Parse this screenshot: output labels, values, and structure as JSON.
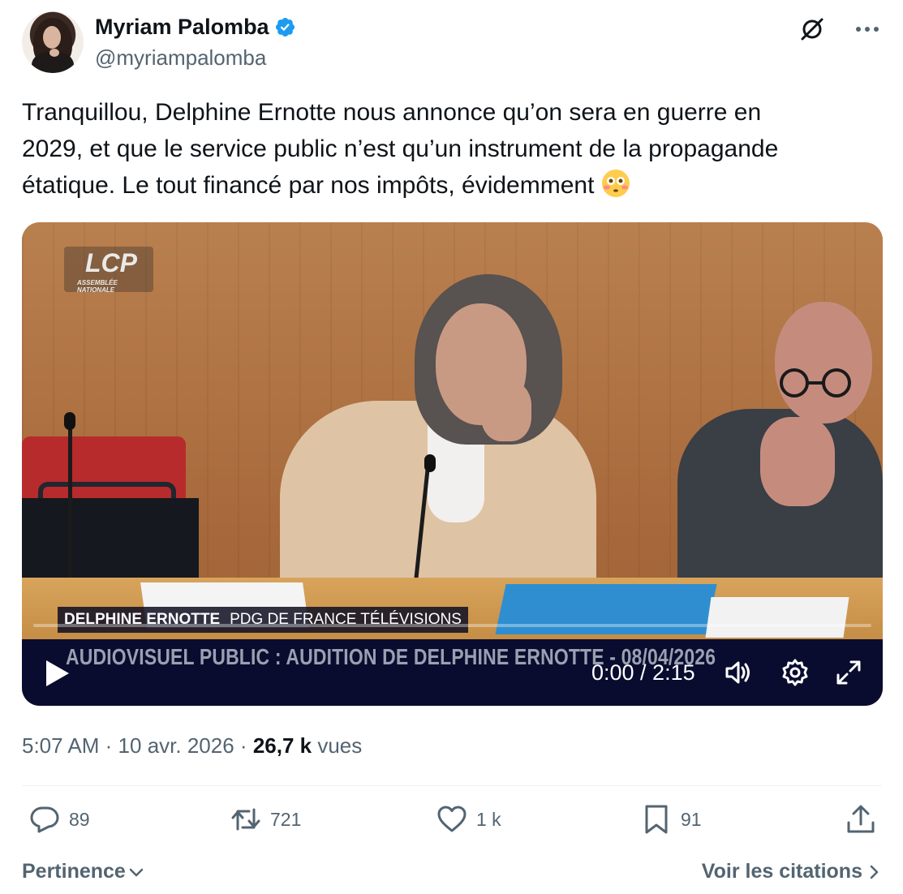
{
  "author": {
    "name": "Myriam Palomba",
    "handle": "@myriampalomba",
    "verified_color": "#1d9bf0"
  },
  "header_icons": {
    "grok": "slashed-circle-icon",
    "more": "more-icon"
  },
  "tweet": {
    "text_line1": "Tranquillou, Delphine Ernotte nous annonce qu’on sera en guerre en",
    "text_line2": "2029, et que le service public n’est qu’un instrument de la propagande",
    "text_line3": "étatique. Le tout financé par nos impôts,  évidemment",
    "emoji": "flushed-face-emoji"
  },
  "video": {
    "logo_main": "LCP",
    "logo_sub": "ASSEMBLÉE NATIONALE",
    "lower_third_name": "DELPHINE ERNOTTE",
    "lower_third_role": "PDG DE FRANCE TÉLÉVISIONS",
    "banner": "AUDIOVISUEL PUBLIC : AUDITION DE DELPHINE ERNOTTE - 08/04/2026",
    "time": "0:00 / 2:15",
    "progress": 0
  },
  "meta": {
    "time": "5:07 AM",
    "date": "10 avr. 2026",
    "views_count": "26,7 k",
    "views_label": "vues"
  },
  "actions": {
    "replies": "89",
    "reposts": "721",
    "likes": "1 k",
    "bookmarks": "91"
  },
  "footer": {
    "sort_label": "Pertinence",
    "quotes_label": "Voir les citations"
  },
  "colors": {
    "text": "#0f1419",
    "secondary": "#536471",
    "video_bar": "#090c2f"
  }
}
